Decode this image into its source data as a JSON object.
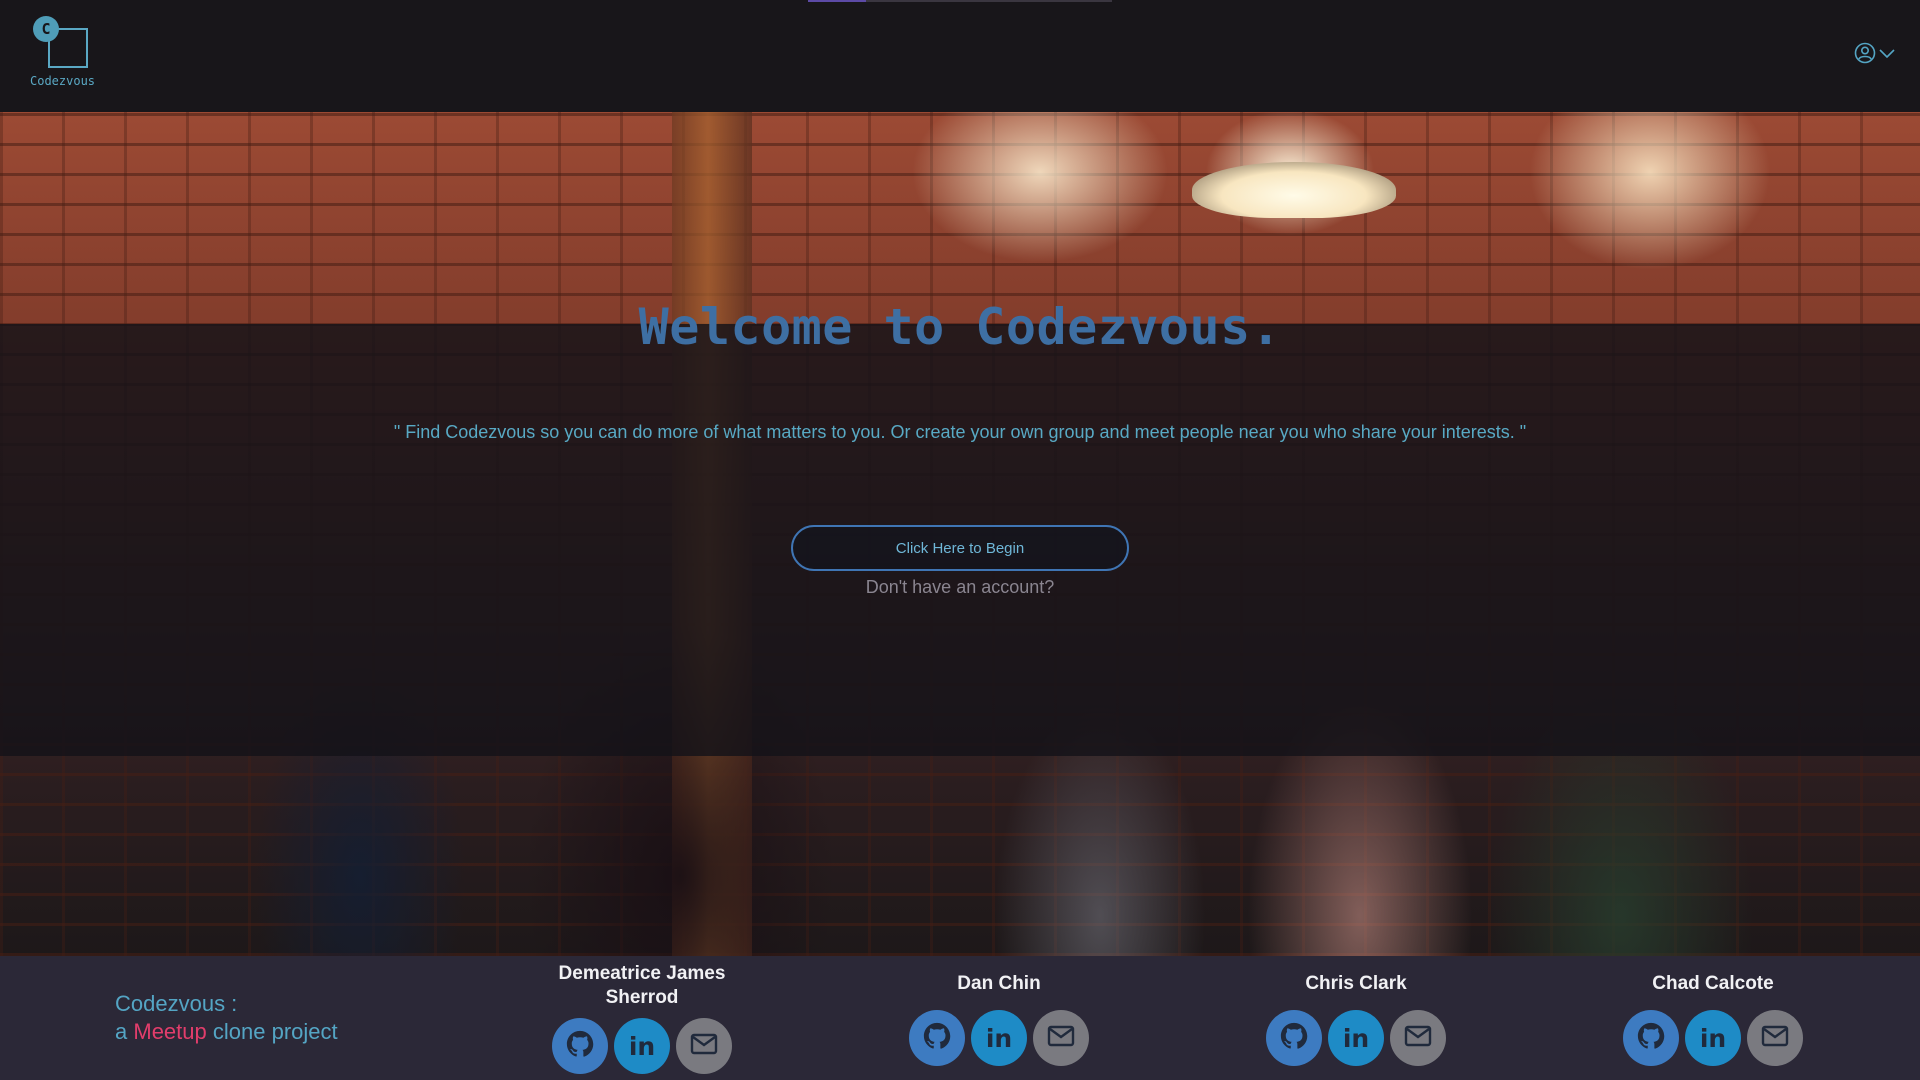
{
  "colors": {
    "navbar_bg": "#18161a",
    "brand_teal": "#54a5c4",
    "title_blue": "#3e6fa3",
    "button_border": "#3f75b4",
    "meetup_accent": "#e23d6b",
    "footer_bg": "#2b2837"
  },
  "navbar": {
    "logo_letter": "C",
    "logo_text": "Codezvous",
    "user_icon": "user-circle-icon",
    "menu_icon": "chevron-down-icon"
  },
  "hero": {
    "title": "Welcome to Codezvous.",
    "quote": "\" Find Codezvous so you can do more of what matters to you. Or create your own group and meet people near you who share your interests. \"",
    "begin_button": "Click Here to Begin",
    "signup_link": "Don't have an account?"
  },
  "footer": {
    "brand_line1": "Codezvous :",
    "brand_a": "a",
    "brand_meetup": "Meetup",
    "brand_rest": "clone project",
    "members": [
      {
        "name": "Demeatrice James Sherrod",
        "icons": [
          "github-icon",
          "linkedin-icon",
          "email-icon"
        ]
      },
      {
        "name": "Dan Chin",
        "icons": [
          "github-icon",
          "linkedin-icon",
          "email-icon"
        ]
      },
      {
        "name": "Chris Clark",
        "icons": [
          "github-icon",
          "linkedin-icon",
          "email-icon"
        ]
      },
      {
        "name": "Chad Calcote",
        "icons": [
          "github-icon",
          "linkedin-icon",
          "email-icon"
        ]
      }
    ],
    "linkedin_label": "in"
  }
}
